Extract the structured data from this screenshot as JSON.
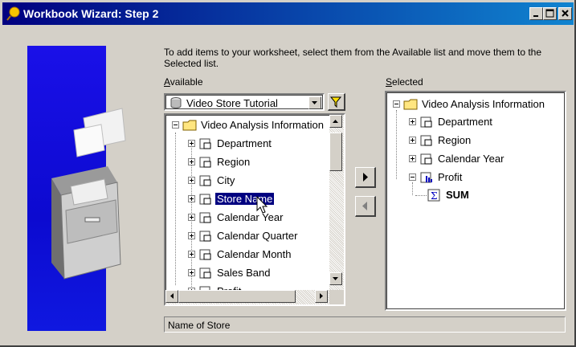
{
  "window": {
    "title": "Workbook Wizard: Step 2"
  },
  "instructions": "To add items to your worksheet, select them from the Available list and move them to the Selected list.",
  "available": {
    "label": "Available",
    "business_area": "Video Store Tutorial",
    "tree": {
      "root": "Video Analysis Information",
      "items": [
        "Department",
        "Region",
        "City",
        "Store Name",
        "Calendar Year",
        "Calendar Quarter",
        "Calendar Month",
        "Sales Band",
        "Profit"
      ],
      "selected_item": "Store Name"
    }
  },
  "selected": {
    "label": "Selected",
    "tree": {
      "root": "Video Analysis Information",
      "items": [
        "Department",
        "Region",
        "Calendar Year",
        "Profit"
      ],
      "profit_children": [
        "SUM"
      ]
    }
  },
  "status_text": "Name of Store",
  "buttons": {
    "add_icon": "arrow-right-icon",
    "remove_icon": "arrow-left-icon"
  },
  "colors": {
    "title_start": "#000080",
    "title_end": "#1084d0",
    "selection": "#000080",
    "art_blue": "#0c0ad0"
  }
}
